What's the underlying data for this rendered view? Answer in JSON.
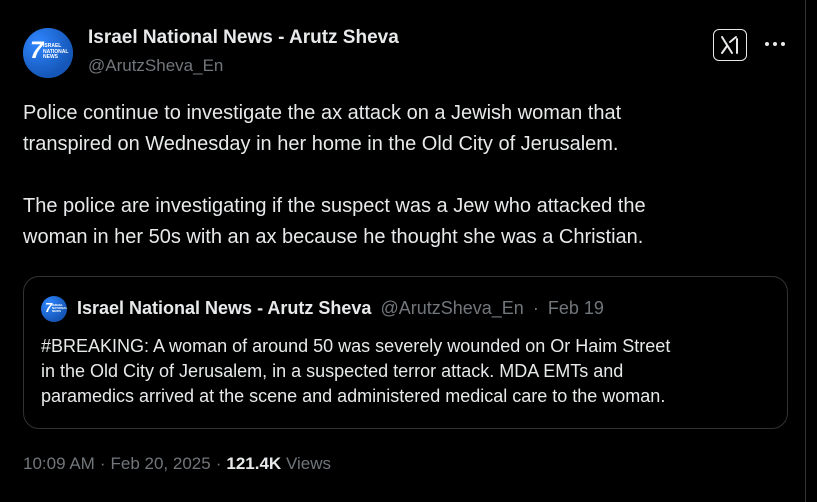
{
  "colors": {
    "background": "#000000",
    "primary_text": "#e7e9ea",
    "secondary_text": "#71767b",
    "border": "#2f3336",
    "avatar_blue": "#1d6fd8"
  },
  "author": {
    "display_name": "Israel National News - Arutz Sheva",
    "handle": "@ArutzSheva_En",
    "avatar_logo_number": "7",
    "avatar_logo_text": [
      "ISRAEL",
      "NATIONAL",
      "NEWS"
    ]
  },
  "actions": {
    "grok_icon": "grok-icon",
    "more_icon": "more-horizontal-icon"
  },
  "tweet": {
    "lines_p1": [
      "Police continue to investigate the ax attack on a Jewish woman that",
      "transpired on Wednesday in her home in the Old City of Jerusalem."
    ],
    "lines_p2": [
      "The police are investigating if the suspect was a Jew who attacked the",
      "woman in her 50s with an ax because he thought she was a Christian."
    ]
  },
  "quote": {
    "display_name": "Israel National News - Arutz Sheva",
    "handle": "@ArutzSheva_En",
    "separator": "·",
    "date": "Feb 19",
    "lines": [
      "#BREAKING: A woman of around 50 was severely wounded on Or Haim Street",
      "in the Old City of Jerusalem, in a suspected terror attack. MDA EMTs and",
      "paramedics arrived at the scene and administered medical care to the woman."
    ]
  },
  "meta": {
    "time": "10:09 AM",
    "separator": "·",
    "date": "Feb 20, 2025",
    "views_count": "121.4K",
    "views_label": "Views"
  }
}
